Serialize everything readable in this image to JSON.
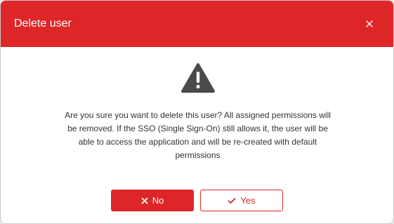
{
  "dialog": {
    "title": "Delete user",
    "close_icon": "close-icon",
    "warning_icon": "warning-triangle-icon",
    "message": "Are you sure you want to delete this user? All assigned permissions will be removed. If the SSO (Single Sign-On) still allows it, the user will be able to access the application and will be re-created with default permissions",
    "no_label": "No",
    "no_icon": "x-icon",
    "yes_label": "Yes",
    "yes_icon": "check-icon"
  },
  "colors": {
    "accent": "#de2629",
    "icon_gray": "#4a4a4a",
    "text": "#333333"
  }
}
